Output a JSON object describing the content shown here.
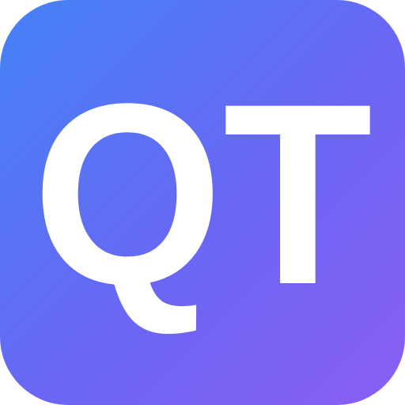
{
  "icon": {
    "name": "qt-app-icon",
    "monogram": "QT",
    "letter_color": "#ffffff",
    "gradient": {
      "start": "#4482f6",
      "mid": "#6a66f3",
      "end": "#8a5ef2"
    }
  }
}
